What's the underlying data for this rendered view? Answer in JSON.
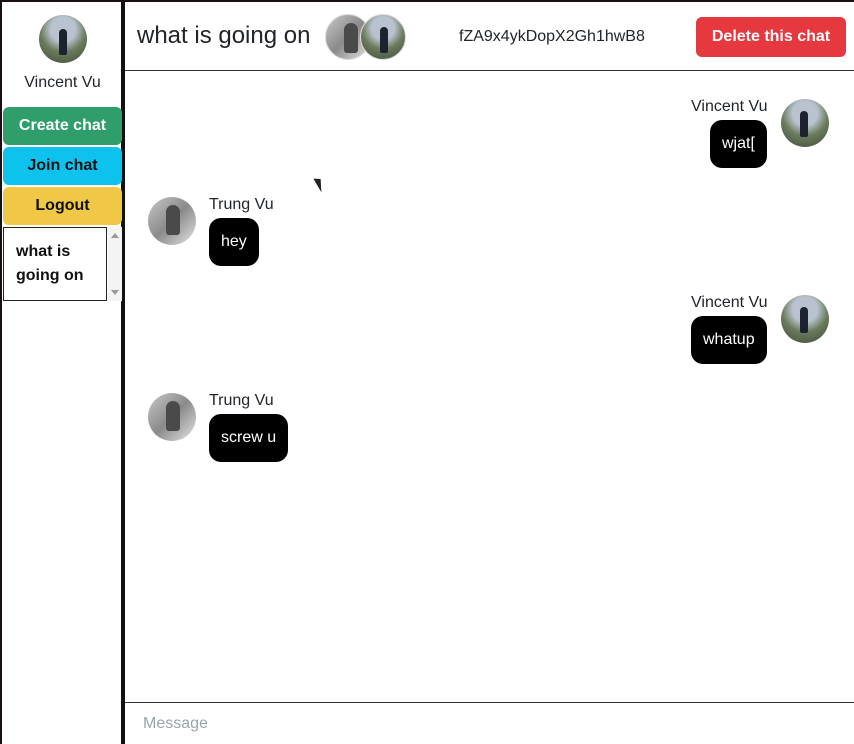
{
  "current_user": {
    "name": "Vincent Vu"
  },
  "sidebar": {
    "buttons": {
      "create": "Create chat",
      "join": "Join chat",
      "logout": "Logout"
    },
    "chats": [
      {
        "title": "what is going on"
      }
    ]
  },
  "chat": {
    "title": "what is going on",
    "id": "fZA9x4ykDopX2Gh1hwB8",
    "delete_label": "Delete this chat",
    "members": [
      "Trung Vu",
      "Vincent Vu"
    ]
  },
  "messages": [
    {
      "sender": "Vincent Vu",
      "text": "wjat[",
      "own": true
    },
    {
      "sender": "Trung Vu",
      "text": "hey",
      "own": false
    },
    {
      "sender": "Vincent Vu",
      "text": "whatup",
      "own": true
    },
    {
      "sender": "Trung Vu",
      "text": "screw u",
      "own": false
    }
  ],
  "composer": {
    "placeholder": "Message",
    "value": ""
  },
  "colors": {
    "create": "#2f9e6a",
    "join": "#0dc3ee",
    "logout": "#f0c846",
    "delete": "#e5383f",
    "bubble": "#000000"
  }
}
